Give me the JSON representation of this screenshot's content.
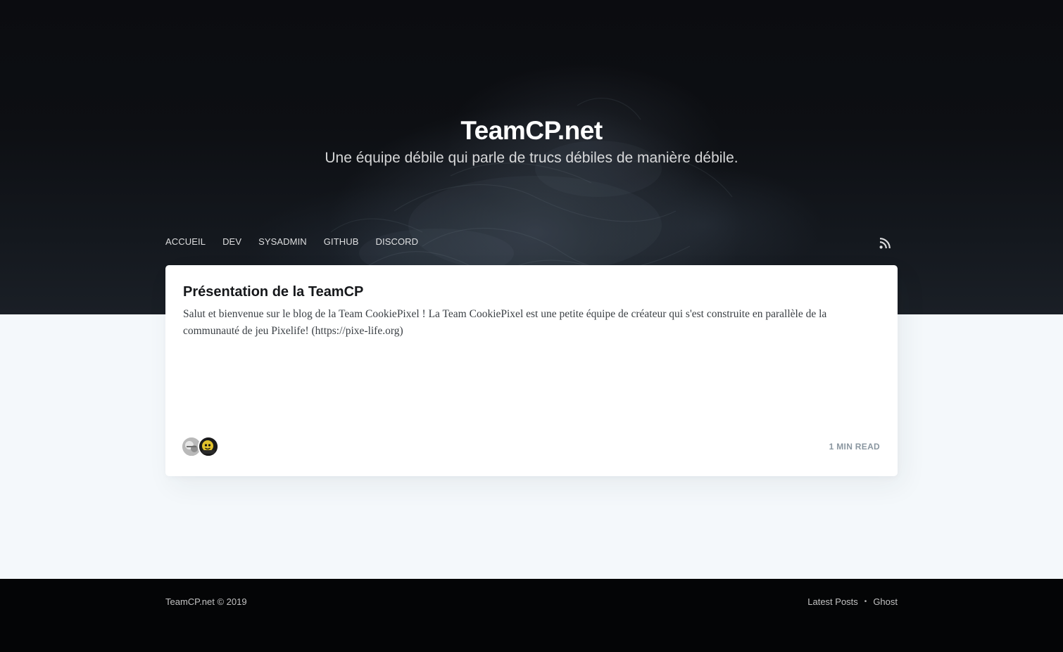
{
  "header": {
    "title": "TeamCP.net",
    "description": "Une équipe débile qui parle de trucs débiles de manière débile."
  },
  "nav": {
    "items": [
      {
        "label": "Accueil"
      },
      {
        "label": "Dev"
      },
      {
        "label": "Sysadmin"
      },
      {
        "label": "GitHub"
      },
      {
        "label": "Discord"
      }
    ],
    "rss_icon": "rss-icon"
  },
  "posts": [
    {
      "title": "Présentation de la TeamCP",
      "excerpt": "Salut et bienvenue sur le blog de la Team CookiePixel ! La Team CookiePixel est une petite équipe de créateur qui s'est construite en parallèle de la communauté de jeu Pixelife! (https://pixe-life.org)",
      "reading_time": "1 min read",
      "authors": [
        "author-avatar-1",
        "author-avatar-2"
      ]
    }
  ],
  "footer": {
    "copyright": "TeamCP.net © 2019",
    "links": [
      {
        "label": "Latest Posts"
      },
      {
        "label": "Ghost"
      }
    ],
    "separator": "•"
  },
  "colors": {
    "page_bg": "#f4f8fb",
    "header_bg": "#0d0f13",
    "footer_bg": "#040506",
    "card_bg": "#ffffff",
    "title_text": "#15171a",
    "meta_text": "#8a96a0"
  }
}
